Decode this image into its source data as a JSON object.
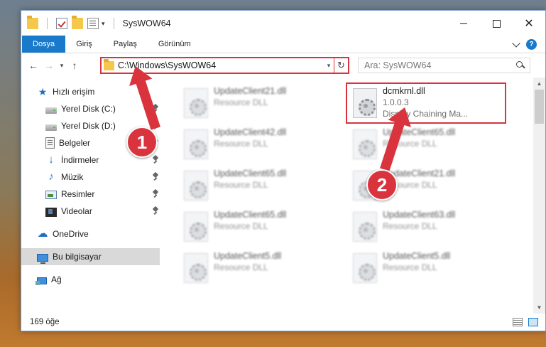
{
  "window": {
    "title": "SysWOW64"
  },
  "ribbon": {
    "tabs": [
      "Dosya",
      "Giriş",
      "Paylaş",
      "Görünüm"
    ],
    "help_label": "?"
  },
  "window_controls": {
    "minimize": "",
    "maximize": "",
    "close": "✕"
  },
  "navigation": {
    "back": "←",
    "forward": "→",
    "recent": "▾",
    "up": "↑"
  },
  "address": {
    "path": "C:\\Windows\\SysWOW64",
    "dropdown": "▾",
    "refresh": "↻"
  },
  "search": {
    "placeholder": "Ara: SysWOW64"
  },
  "sidebar": {
    "items": [
      {
        "label": "Hızlı erişim",
        "icon": "star-icon",
        "glyph": "★"
      },
      {
        "label": "Yerel Disk (C:)",
        "icon": "disk-icon",
        "pinned": true
      },
      {
        "label": "Yerel Disk (D:)",
        "icon": "disk-icon",
        "pinned": true
      },
      {
        "label": "Belgeler",
        "icon": "documents-icon",
        "pinned": true
      },
      {
        "label": "İndirmeler",
        "icon": "download-icon",
        "glyph": "↓",
        "pinned": true
      },
      {
        "label": "Müzik",
        "icon": "music-icon",
        "glyph": "♪",
        "pinned": true
      },
      {
        "label": "Resimler",
        "icon": "pictures-icon",
        "pinned": true
      },
      {
        "label": "Videolar",
        "icon": "video-icon",
        "pinned": true
      },
      {
        "label": "OneDrive",
        "icon": "cloud-icon",
        "glyph": "☁"
      },
      {
        "label": "Bu bilgisayar",
        "icon": "computer-icon",
        "selected": true
      },
      {
        "label": "Ağ",
        "icon": "network-icon"
      }
    ]
  },
  "files": [
    {
      "name": "UpdateClient21.dll",
      "desc": "Resource DLL",
      "blurred": true
    },
    {
      "name": "dcmkrnl.dll",
      "version": "1.0.0.3",
      "desc": "Display Chaining Ma...",
      "blurred": false
    },
    {
      "name": "UpdateClient42.dll",
      "desc": "Resource DLL",
      "blurred": true
    },
    {
      "name": "UpdateClient65.dll",
      "desc": "Resource DLL",
      "blurred": true
    },
    {
      "name": "UpdateClient65.dll",
      "desc": "Resource DLL",
      "blurred": true
    },
    {
      "name": "UpdateClient21.dll",
      "desc": "Resource DLL",
      "blurred": true
    },
    {
      "name": "UpdateClient65.dll",
      "desc": "Resource DLL",
      "blurred": true
    },
    {
      "name": "UpdateClient63.dll",
      "desc": "Resource DLL",
      "blurred": true
    },
    {
      "name": "UpdateClient5.dll",
      "desc": "Resource DLL",
      "blurred": true
    },
    {
      "name": "UpdateClient5.dll",
      "desc": "Resource DLL",
      "blurred": true
    }
  ],
  "status": {
    "count": "169 öğe"
  },
  "annotations": {
    "step1": "1",
    "step2": "2"
  },
  "colors": {
    "accent": "#1979ca",
    "highlight": "#d9343d"
  }
}
